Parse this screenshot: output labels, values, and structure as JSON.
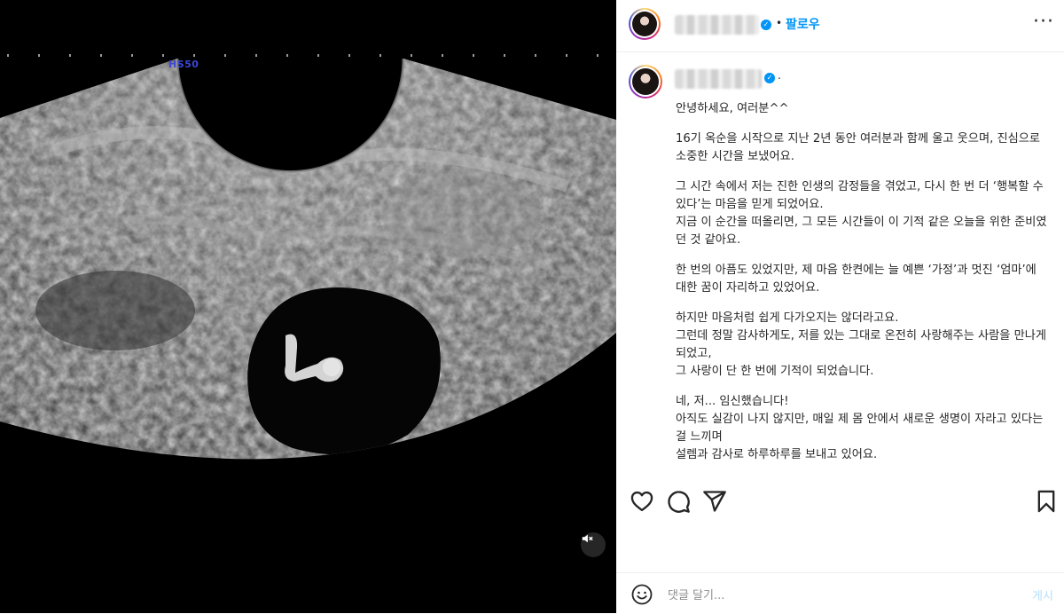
{
  "post": {
    "media": {
      "scan_label": "HS50",
      "mute_icon": "speaker-muted-icon"
    },
    "header": {
      "follow_label": "팔로우",
      "separator": "•",
      "more_label": "···"
    },
    "caption": {
      "separator": ".",
      "paragraphs": [
        "안녕하세요, 여러분^^",
        "16기 옥순을 시작으로 지난 2년 동안 여러분과 함께 울고 웃으며, 진심으로 소중한 시간을 보냈어요.",
        "그 시간 속에서 저는 진한 인생의 감정들을 겪었고, 다시 한 번 더 ‘행복할 수 있다’는 마음을 믿게 되었어요.\n지금 이 순간을 떠올리면, 그 모든 시간들이 이 기적 같은 오늘을 위한 준비였던 것 같아요.",
        "한 번의 아픔도 있었지만, 제 마음 한켠에는 늘 예쁜 ‘가정’과 멋진 ‘엄마’에 대한 꿈이 자리하고 있었어요.",
        "하지만 마음처럼 쉽게 다가오지는 않더라고요.\n그런데 정말 감사하게도, 저를 있는 그대로 온전히 사랑해주는 사람을 만나게 되었고,\n그 사랑이 단 한 번에 기적이 되었습니다.",
        "네, 저... 임신했습니다!\n아직도 실감이 나지 않지만, 매일 제 몸 안에서 새로운 생명이 자라고 있다는 걸 느끼며\n설렘과 감사로 하루하루를 보내고 있어요."
      ]
    },
    "actions": {
      "icons": [
        "heart-icon",
        "comment-icon",
        "share-icon",
        "bookmark-icon"
      ]
    },
    "comment_bar": {
      "placeholder": "댓글 달기...",
      "post_label": "게시",
      "emoji_icon": "smiley-icon"
    }
  }
}
